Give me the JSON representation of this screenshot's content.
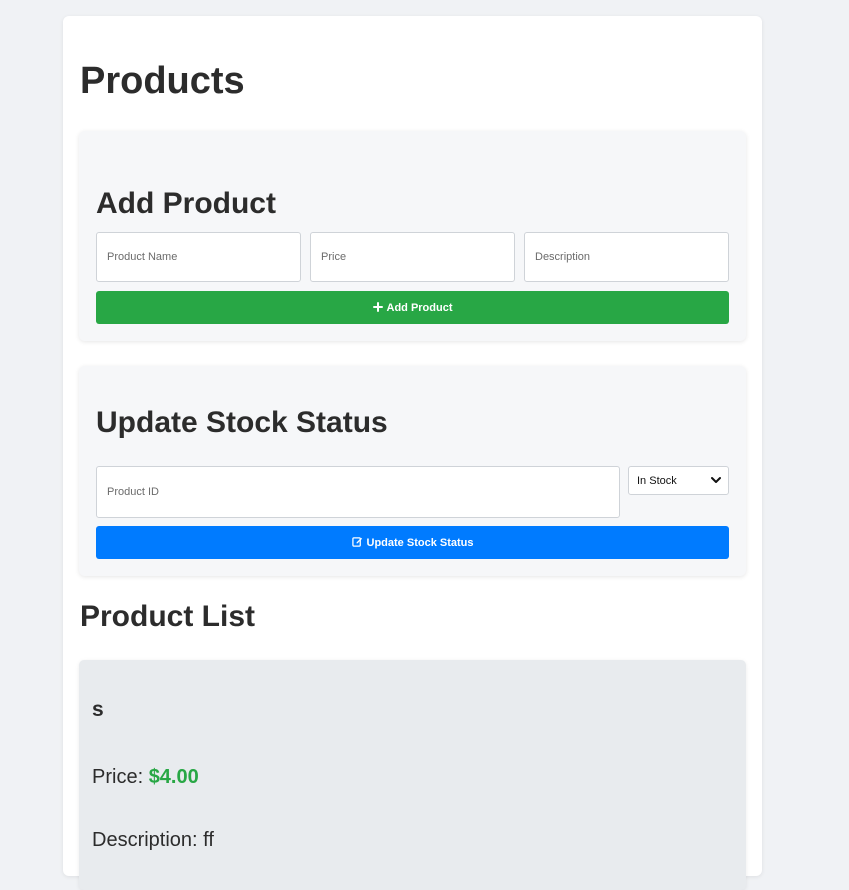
{
  "page": {
    "title": "Products"
  },
  "add_product": {
    "title": "Add Product",
    "name_placeholder": "Product Name",
    "price_placeholder": "Price",
    "description_placeholder": "Description",
    "button_label": "Add Product",
    "button_icon": "plus-icon",
    "button_color": "#28a745"
  },
  "update_stock": {
    "title": "Update Stock Status",
    "product_id_placeholder": "Product ID",
    "status_selected": "In Stock",
    "button_label": "Update Stock Status",
    "button_icon": "edit-icon",
    "button_color": "#007bff"
  },
  "product_list": {
    "title": "Product List",
    "items": [
      {
        "name": "s",
        "price_label": "Price: ",
        "price_value": "$4.00",
        "description_label": "Description: ",
        "description_value": "ff"
      }
    ]
  },
  "colors": {
    "background": "#f0f2f5",
    "card": "#f6f7f9",
    "product_item": "#e8ebee",
    "price_accent": "#28a745"
  }
}
